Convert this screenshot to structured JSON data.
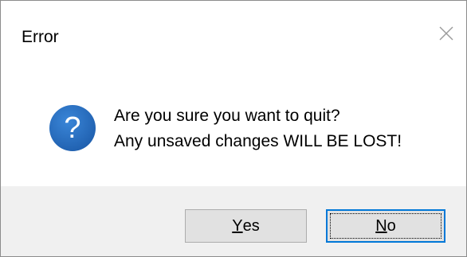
{
  "window": {
    "title": "Error",
    "close_icon": "close-icon"
  },
  "message": {
    "icon": "question-icon",
    "icon_glyph": "?",
    "line1": "Are you sure you want to quit?",
    "line2": "Any unsaved changes WILL BE LOST!"
  },
  "buttons": {
    "yes": {
      "mnemonic": "Y",
      "rest": "es"
    },
    "no": {
      "mnemonic": "N",
      "rest": "o",
      "focused": true
    }
  },
  "colors": {
    "accent": "#0078d7",
    "icon_blue": "#1f5fae",
    "footer_bg": "#f0f0f0",
    "button_bg": "#e1e1e1"
  }
}
